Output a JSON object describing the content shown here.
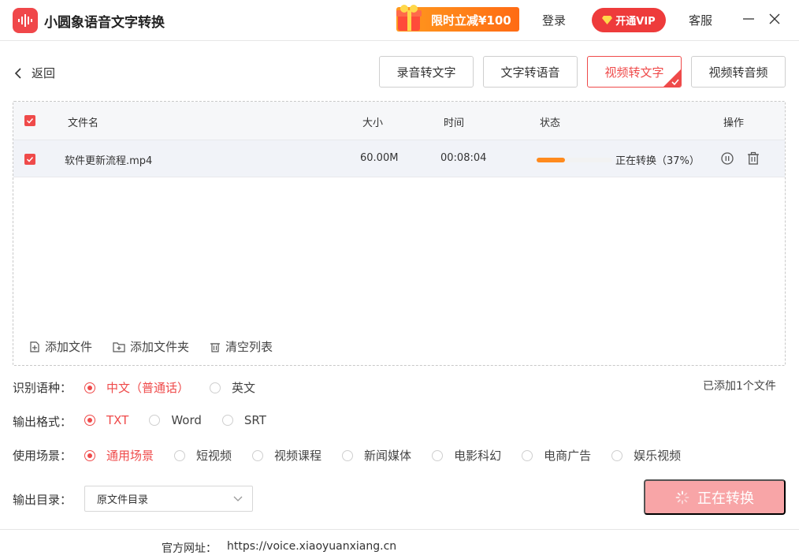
{
  "app": {
    "title": "小圆象语音文字转换",
    "promo_label": "限时立减¥100",
    "login_label": "登录",
    "vip_label": "开通VIP",
    "support_label": "客服",
    "brand_color": "#ef4a4a"
  },
  "nav": {
    "back_label": "返回",
    "tabs": [
      {
        "label": "录音转文字",
        "active": false
      },
      {
        "label": "文字转语音",
        "active": false
      },
      {
        "label": "视频转文字",
        "active": true
      },
      {
        "label": "视频转音频",
        "active": false
      }
    ]
  },
  "file_list": {
    "headers": {
      "name": "文件名",
      "size": "大小",
      "time": "时间",
      "status": "状态",
      "actions": "操作"
    },
    "rows": [
      {
        "name": "软件更新流程.mp4",
        "size": "60.00M",
        "time": "00:08:04",
        "status": "正在转换（37%）",
        "progress": 0.37,
        "checked": true
      }
    ],
    "add_file_label": "添加文件",
    "add_folder_label": "添加文件夹",
    "clear_label": "清空列表"
  },
  "options": {
    "language": {
      "label": "识别语种：",
      "choices": [
        "中文（普通话）",
        "英文"
      ],
      "selected": 0
    },
    "format": {
      "label": "输出格式：",
      "choices": [
        "TXT",
        "Word",
        "SRT"
      ],
      "selected": 0
    },
    "scene": {
      "label": "使用场景：",
      "choices": [
        "通用场景",
        "短视频",
        "视频课程",
        "新闻媒体",
        "电影科幻",
        "电商广告",
        "娱乐视频"
      ],
      "selected": 0
    },
    "added_count": "已添加1个文件",
    "output_dir_label": "输出目录：",
    "output_dir_value": "原文件目录"
  },
  "action": {
    "convert_label": "正在转换"
  },
  "footer": {
    "site_label": "官方网址：",
    "site_url": "https://voice.xiaoyuanxiang.cn"
  }
}
